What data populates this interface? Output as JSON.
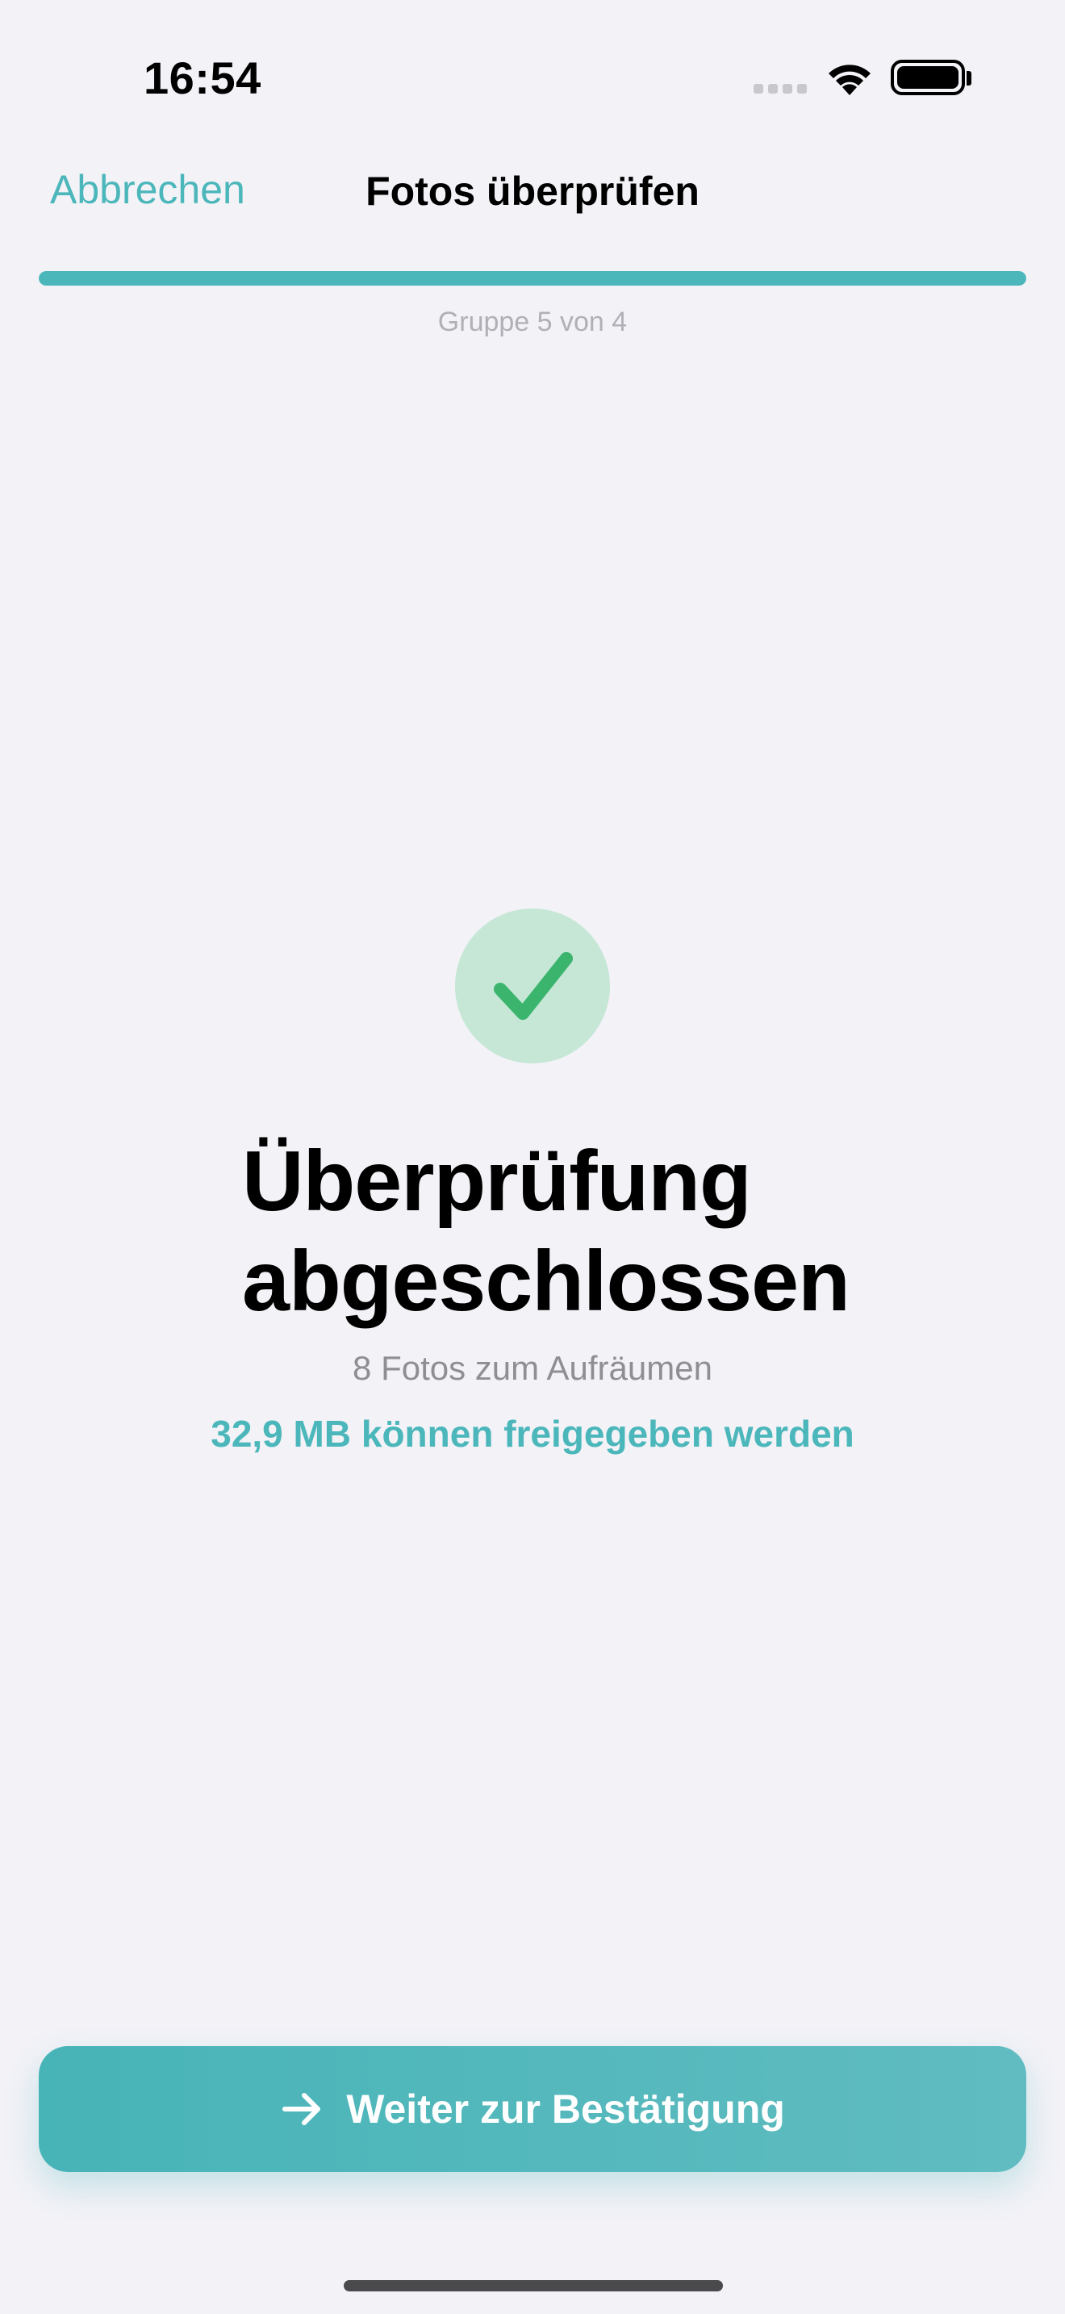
{
  "status_bar": {
    "time": "16:54"
  },
  "nav": {
    "cancel_label": "Abbrechen",
    "title": "Fotos überprüfen"
  },
  "progress": {
    "label": "Gruppe 5 von 4",
    "fraction": 1.0
  },
  "result": {
    "headline_line1": "Überprüfung",
    "headline_line2": "abgeschlossen",
    "subtitle": "8 Fotos zum Aufräumen",
    "savings": "32,9 MB können freigegeben werden"
  },
  "actions": {
    "continue_label": "Weiter zur Bestätigung"
  },
  "icons": {
    "check": "checkmark-icon",
    "arrow": "arrow-right-icon",
    "wifi": "wifi-icon",
    "battery": "battery-icon",
    "signal": "cellular-signal-icon"
  },
  "colors": {
    "accent": "#4bb7bb",
    "success": "#3bb56e",
    "success_bg": "#c6e7d6",
    "background": "#f2f2f7",
    "secondary_text": "#8e8e93"
  }
}
